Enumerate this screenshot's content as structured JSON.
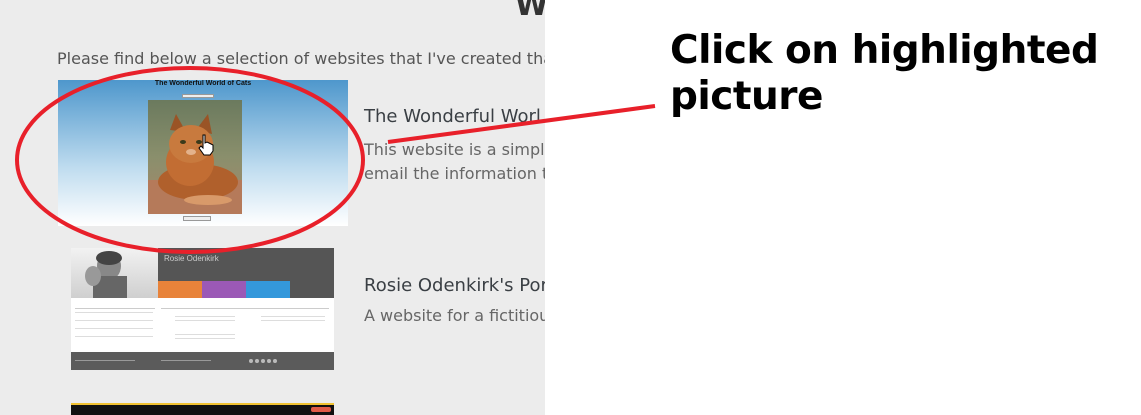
{
  "page": {
    "heading": "W",
    "intro": "Please find below a selection of websites that I've created that showc"
  },
  "projects": [
    {
      "title": "The Wonderful Worl",
      "desc_line1": "This website is a simple w",
      "desc_line2": "email the information to t",
      "thumbnail": {
        "title": "The Wonderful World of Cats"
      }
    },
    {
      "title": "Rosie Odenkirk's Por",
      "desc_line1": "A website for a fictitious W",
      "thumbnail": {
        "name": "Rosie Odenkirk"
      }
    }
  ],
  "annotation": {
    "line1": "Click on highlighted",
    "line2": "picture",
    "color": "#e8202a"
  }
}
